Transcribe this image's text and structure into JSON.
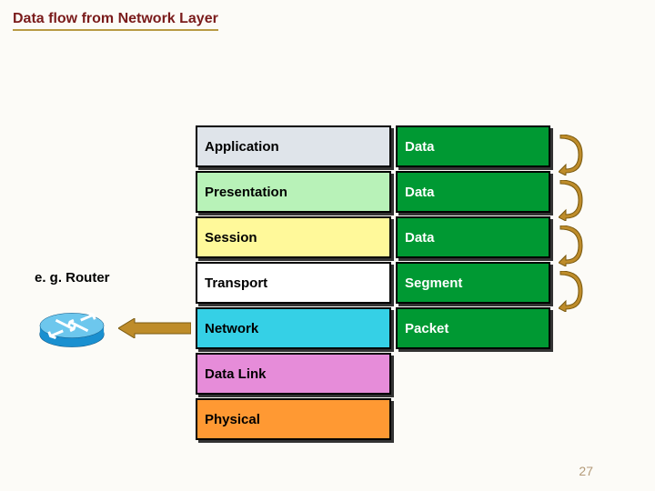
{
  "title": "Data flow from Network Layer",
  "router_label": "e. g. Router",
  "page_number": "27",
  "layers": [
    {
      "name": "Application",
      "pdu": "Data",
      "bg": "#dfe4ea"
    },
    {
      "name": "Presentation",
      "pdu": "Data",
      "bg": "#b8f2b8"
    },
    {
      "name": "Session",
      "pdu": "Data",
      "bg": "#fff99a"
    },
    {
      "name": "Transport",
      "pdu": "Segment",
      "bg": "#ffffff"
    },
    {
      "name": "Network",
      "pdu": "Packet",
      "bg": "#35d0e6"
    },
    {
      "name": "Data Link",
      "pdu": "",
      "bg": "#e68cd9"
    },
    {
      "name": "Physical",
      "pdu": "",
      "bg": "#ff9933"
    }
  ],
  "colors": {
    "pdu_bg": "#009933",
    "title_color": "#7a1b1b",
    "accent": "#b89a44"
  }
}
